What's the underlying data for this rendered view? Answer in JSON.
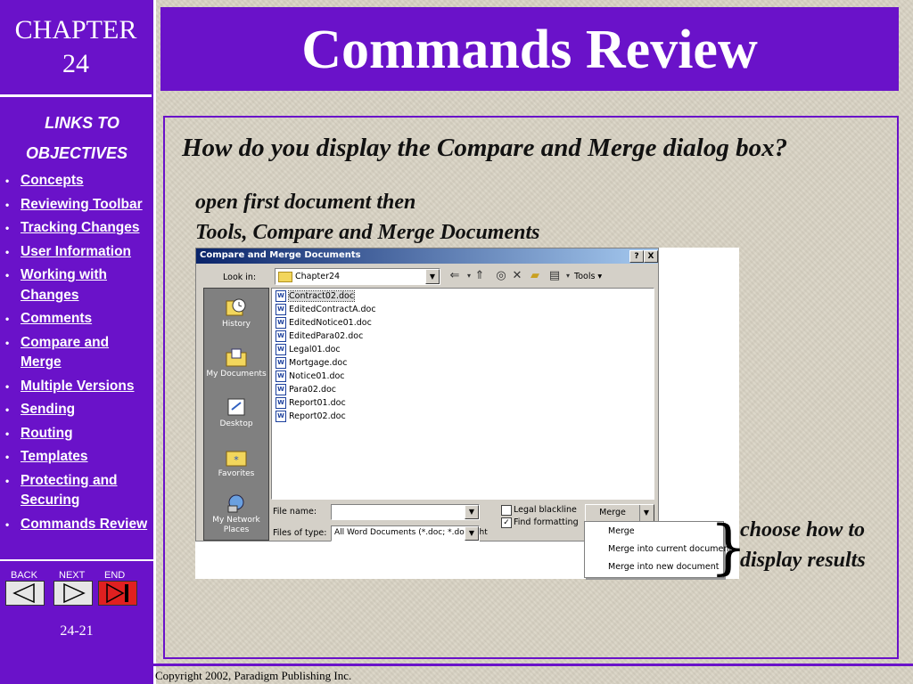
{
  "chapter": {
    "label": "CHAPTER",
    "number": "24"
  },
  "title": "Commands Review",
  "sidebar": {
    "links_title_1": "LINKS TO",
    "links_title_2": "OBJECTIVES",
    "items": [
      {
        "label": "Concepts"
      },
      {
        "label": "Reviewing Toolbar"
      },
      {
        "label": "Tracking Changes"
      },
      {
        "label": "User Information"
      },
      {
        "label": "Working with Changes"
      },
      {
        "label": "Comments"
      },
      {
        "label": "Compare and Merge"
      },
      {
        "label": "Multiple Versions"
      },
      {
        "label": "Sending"
      },
      {
        "label": "Routing"
      },
      {
        "label": "Templates"
      },
      {
        "label": "Protecting and Securing"
      },
      {
        "label": "Commands Review"
      }
    ],
    "nav": {
      "back": "BACK",
      "next": "NEXT",
      "end": "END"
    },
    "page_number": "24-21"
  },
  "content": {
    "question": "How do you display the Compare and Merge dialog box?",
    "answer_line1": "open first document then",
    "answer_line2": "Tools, Compare and Merge Documents",
    "callout_line1": "choose how to",
    "callout_line2": "display results"
  },
  "dialog": {
    "title": "Compare and Merge Documents",
    "help_btn": "?",
    "close_btn": "X",
    "look_in_label": "Look in:",
    "look_in_value": "Chapter24",
    "tools_label": "Tools",
    "places": [
      "History",
      "My Documents",
      "Desktop",
      "Favorites",
      "My Network Places"
    ],
    "files": [
      "Contract02.doc",
      "EditedContractA.doc",
      "EditedNotice01.doc",
      "EditedPara02.doc",
      "Legal01.doc",
      "Mortgage.doc",
      "Notice01.doc",
      "Para02.doc",
      "Report01.doc",
      "Report02.doc"
    ],
    "file_name_label": "File name:",
    "file_name_value": "",
    "files_of_type_label": "Files of type:",
    "files_of_type_value": "All Word Documents (*.doc; *.dot; *.ht",
    "legal_blackline_label": "Legal blackline",
    "legal_blackline_checked": false,
    "find_formatting_label": "Find formatting",
    "find_formatting_checked": true,
    "merge_button": "Merge",
    "menu_items": [
      "Merge",
      "Merge into current document",
      "Merge into new document"
    ]
  },
  "footer": {
    "copyright": "Copyright 2002, Paradigm Publishing Inc."
  },
  "colors": {
    "accent": "#6a12c9",
    "background": "#d9d3c4",
    "dialog_title": "#0a246a"
  }
}
